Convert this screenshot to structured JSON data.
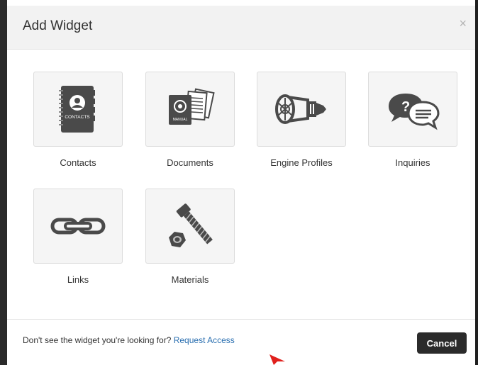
{
  "dialog": {
    "title": "Add Widget",
    "close_symbol": "×"
  },
  "widgets": [
    {
      "label": "Contacts",
      "icon": "contacts-book-icon"
    },
    {
      "label": "Documents",
      "icon": "documents-manual-icon"
    },
    {
      "label": "Engine Profiles",
      "icon": "jet-engine-icon"
    },
    {
      "label": "Inquiries",
      "icon": "speech-bubbles-icon"
    },
    {
      "label": "Links",
      "icon": "chain-link-icon"
    },
    {
      "label": "Materials",
      "icon": "bolt-and-nut-icon"
    }
  ],
  "contacts_icon_text": "CONTACTS",
  "documents_icon_text": "MANUAL",
  "footer": {
    "prompt": "Don't see the widget you're looking for?",
    "link": "Request Access",
    "cancel": "Cancel"
  },
  "colors": {
    "header_bg": "#f2f2f2",
    "tile_bg": "#f5f5f5",
    "icon_dark": "#4a4a4a",
    "link": "#2a6fb0",
    "cancel_bg": "#2b2b2b",
    "pointer": "#e0201c"
  }
}
